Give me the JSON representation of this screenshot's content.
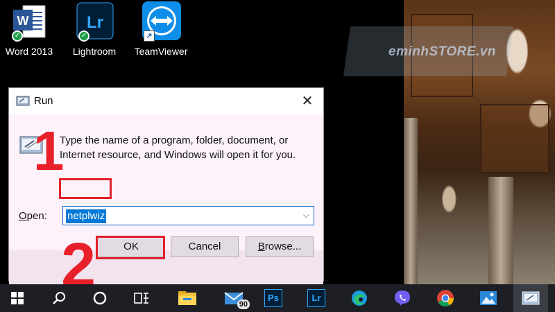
{
  "desktop": {
    "icons": [
      {
        "label": "Word 2013",
        "name": "word-icon"
      },
      {
        "label": "Lightroom",
        "name": "lightroom-icon"
      },
      {
        "label": "TeamViewer",
        "name": "teamviewer-icon"
      }
    ],
    "watermark": "eminhSTORE.vn"
  },
  "run_dialog": {
    "title": "Run",
    "description": "Type the name of a program, folder, document, or Internet resource, and Windows will open it for you.",
    "open_label": "Open:",
    "open_value": "netplwiz",
    "ok_label": "OK",
    "cancel_label": "Cancel",
    "browse_label": "Browse..."
  },
  "annotations": {
    "step1": "1",
    "step2": "2",
    "highlight_color": "#e0202a"
  },
  "taskbar": {
    "items": [
      "windows-start-icon",
      "search-icon",
      "task-view-icon",
      "widgets-icon",
      "file-explorer-icon",
      "mail-icon",
      "photoshop-icon",
      "lightroom-icon",
      "edge-icon",
      "viber-icon",
      "chrome-icon",
      "photos-icon",
      "run-icon"
    ],
    "mail_badge": "90",
    "ps_text": "Ps",
    "lr_text": "Lr"
  }
}
